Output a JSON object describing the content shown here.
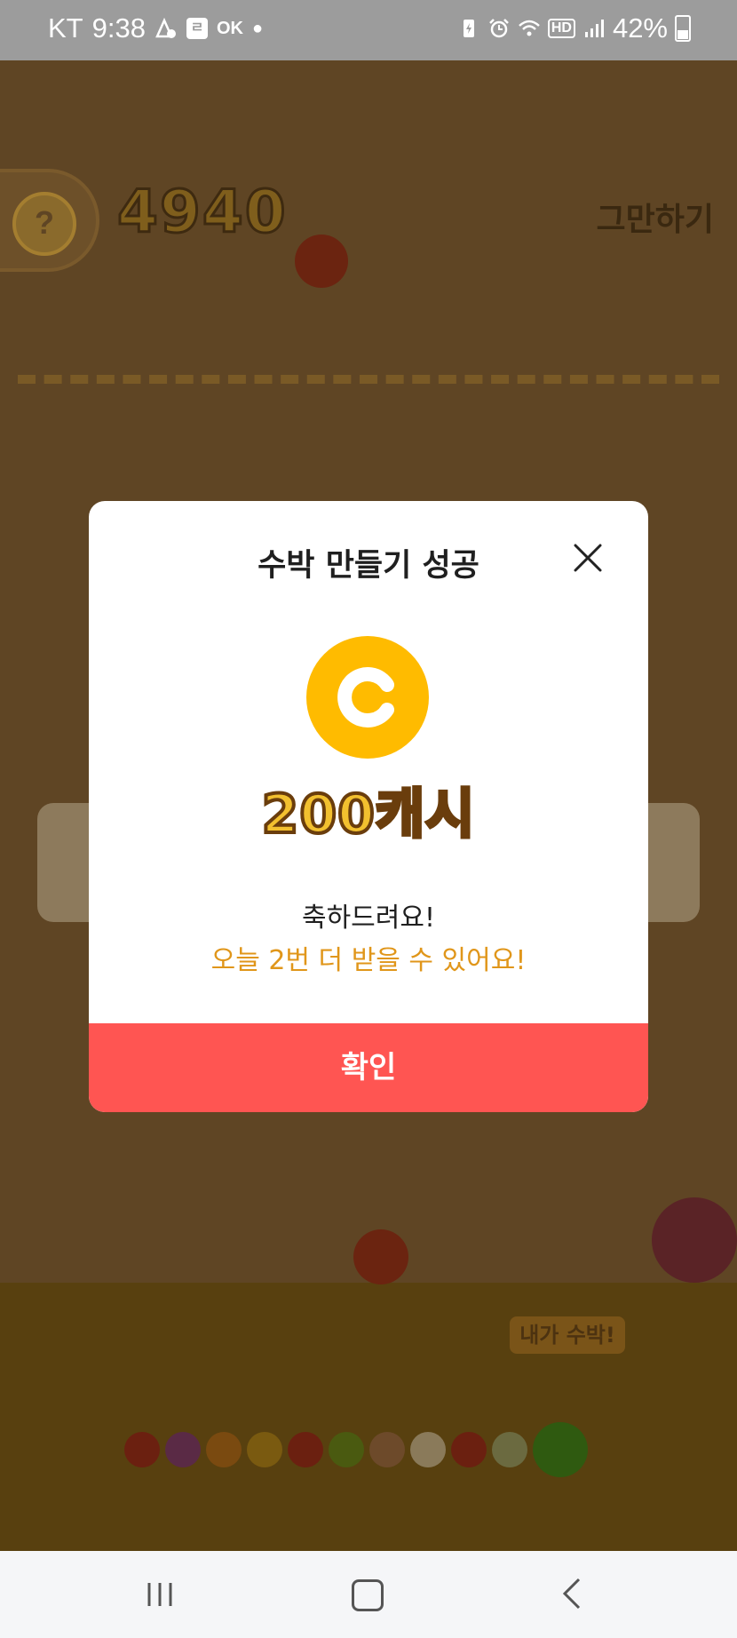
{
  "status_bar": {
    "carrier": "KT",
    "time": "9:38",
    "ok_label": "OK",
    "battery": "42%",
    "icons": [
      "notification-app-icon",
      "message-icon",
      "ok-cashbag-icon",
      "dot-icon",
      "battery-saver-icon",
      "alarm-icon",
      "wifi-icon",
      "hd-icon",
      "signal-icon",
      "battery-icon"
    ]
  },
  "game": {
    "help_label": "?",
    "score": "4940",
    "stop_label": "그만하기",
    "goal_bubble": "내가 수박!"
  },
  "modal": {
    "title": "수박 만들기 성공",
    "reward_icon": "cash-coin-icon",
    "reward_text": "200캐시",
    "message": "축하드려요!",
    "sub_message": "오늘 2번 더 받을 수 있어요!",
    "confirm_label": "확인"
  },
  "colors": {
    "accent_red": "#ff5552",
    "coin_yellow": "#ffbb00",
    "sub_message_orange": "#e0961a",
    "game_overlay_brown": "#5f4524"
  },
  "fruit_chain_colors": [
    "#6b2010",
    "#5a2a45",
    "#7a4a10",
    "#7a5a10",
    "#6b2010",
    "#4a5a10",
    "#6d4a2a",
    "#8a7a5a",
    "#6b2010",
    "#6b6a40",
    "#2f5a10"
  ],
  "navbar": {
    "icons": [
      "recent-apps-icon",
      "home-icon",
      "back-icon"
    ]
  }
}
